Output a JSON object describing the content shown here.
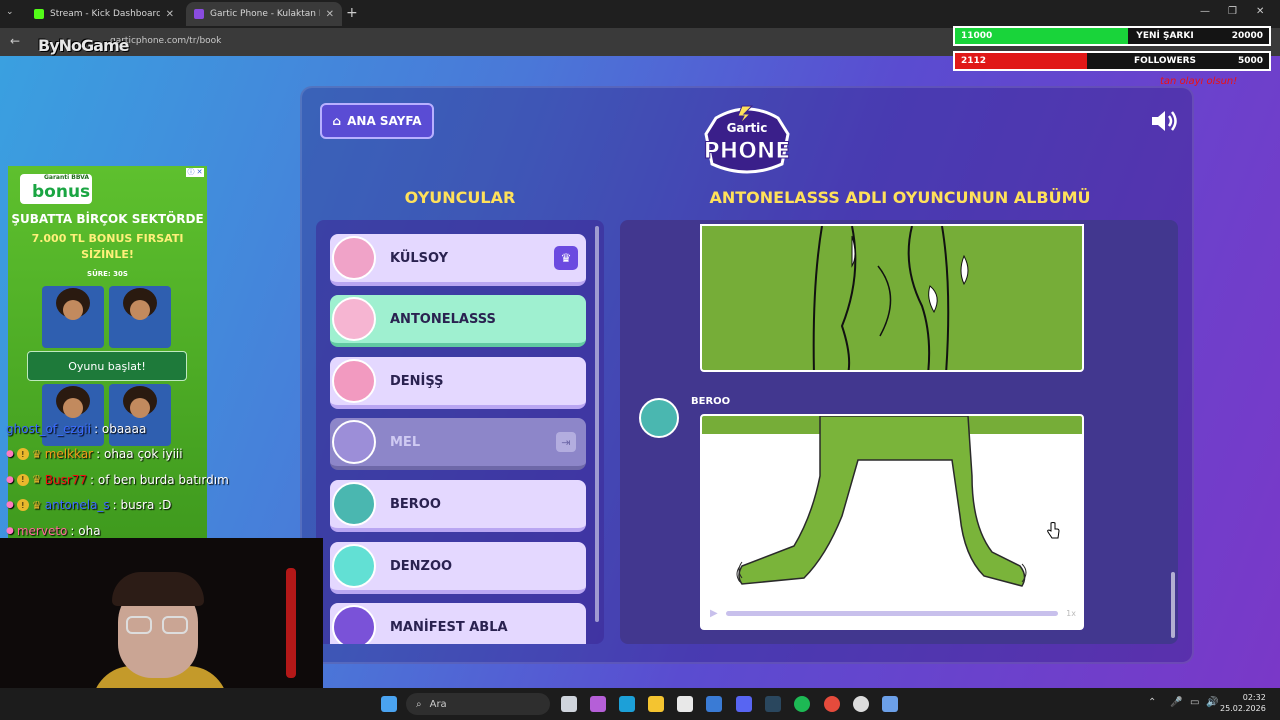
{
  "browser": {
    "tabs": [
      {
        "title": "Stream - Kick Dashboard",
        "favicon_color": "#53fc18",
        "active": false
      },
      {
        "title": "Gartic Phone - Kulaktan Kulağa",
        "favicon_color": "#8a4ce0",
        "active": true
      }
    ],
    "new_tab_icon": "+",
    "url": "garticphone.com/tr/book",
    "overlay_logo": "ByNoGame"
  },
  "stream_overlay": {
    "goal_songs": {
      "current": "11000",
      "label": "YENİ ŞARKI",
      "target": "20000",
      "color": "#19d43a",
      "progress": 0.55
    },
    "goal_followers": {
      "current": "2112",
      "label": "FOLLOWERS",
      "target": "5000",
      "color": "#e01818",
      "progress": 0.42
    },
    "red_text": "tan olayı olsun!"
  },
  "game": {
    "home_button": "ANA SAYFA",
    "logo_top": "Gartic",
    "logo_bottom": "PHONE",
    "players_title": "OYUNCULAR",
    "album_title": "ANTONELASSS ADLI OYUNCUNUN ALBÜMÜ",
    "players": [
      {
        "name": "KÜLSOY",
        "state": "host",
        "avatar_color": "#f0a3c8"
      },
      {
        "name": "ANTONELASSS",
        "state": "active",
        "avatar_color": "#f6b5d2"
      },
      {
        "name": "DENİŞŞ",
        "state": "normal",
        "avatar_color": "#f29ac0"
      },
      {
        "name": "MEL",
        "state": "left",
        "avatar_color": "#9c8ed8"
      },
      {
        "name": "BEROO",
        "state": "normal",
        "avatar_color": "#4ab7b0"
      },
      {
        "name": "DENZOO",
        "state": "normal",
        "avatar_color": "#62e0d4"
      },
      {
        "name": "MANİFEST ABLA",
        "state": "normal",
        "avatar_color": "#7a52d8"
      }
    ],
    "album_entry": {
      "author": "BEROO",
      "speed": "1x"
    }
  },
  "ad": {
    "bank_small": "Garanti BBVA",
    "brand": "bonus",
    "line1": "ŞUBATTA BİRÇOK SEKTÖRDE",
    "line2": "7.000 TL BONUS FIRSATI",
    "line3": "SİZİNLE!",
    "timer": "SÜRE: 30S",
    "button": "Oyunu başlat!"
  },
  "chat": [
    {
      "user": "ghost_of_ezgii",
      "user_color": "#3b6bff",
      "msg": ": obaaaa",
      "badges": false
    },
    {
      "user": "melkkar",
      "user_color": "#f29a1a",
      "msg": ": ohaa çok iyiii",
      "badges": true
    },
    {
      "user": "Busr77",
      "user_color": "#e11",
      "msg": ": of ben burda batırdım",
      "badges": true
    },
    {
      "user": "antonela_s",
      "user_color": "#3b6bff",
      "msg": ": busra :D",
      "badges": true
    },
    {
      "user": "merveto",
      "user_color": "#ff6b9a",
      "msg": ": oha",
      "badges": false
    }
  ],
  "taskbar": {
    "search_placeholder": "Ara",
    "time": "02:32",
    "date": "25.02.2026"
  }
}
